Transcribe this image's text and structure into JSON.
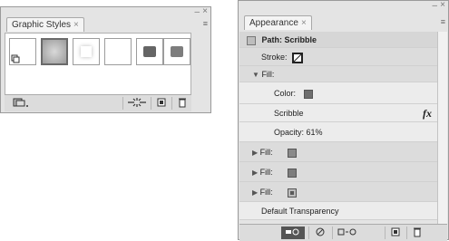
{
  "graphic_styles": {
    "tab_label": "Graphic Styles",
    "tab_close": "×",
    "minimize": "–",
    "close": "×",
    "menu_icon": "≡",
    "swatches": [
      {
        "name": "default",
        "fill": "#ffffff"
      },
      {
        "name": "gradient",
        "fill": "#b0b0b0"
      },
      {
        "name": "white-glow",
        "fill": "#f6f6f6"
      },
      {
        "name": "blank",
        "fill": "#ffffff"
      },
      {
        "name": "dark",
        "fill": "#676767"
      },
      {
        "name": "gray",
        "fill": "#808080"
      }
    ]
  },
  "appearance": {
    "tab_label": "Appearance",
    "tab_close": "×",
    "minimize": "–",
    "close": "×",
    "menu_icon": "≡",
    "path_label": "Path: Scribble",
    "stroke_label": "Stroke:",
    "fill_open_label": "Fill:",
    "color_label": "Color:",
    "scribble_label": "Scribble",
    "fx_label": "fx",
    "opacity_label": "Opacity: 61%",
    "fill_rows": [
      "Fill:",
      "Fill:",
      "Fill:"
    ],
    "default_transparency": "Default Transparency",
    "colors": {
      "swatch_a": "#6e6e6e",
      "swatch_b": "#8a8a8a",
      "swatch_c": "#5a5a5a"
    }
  }
}
